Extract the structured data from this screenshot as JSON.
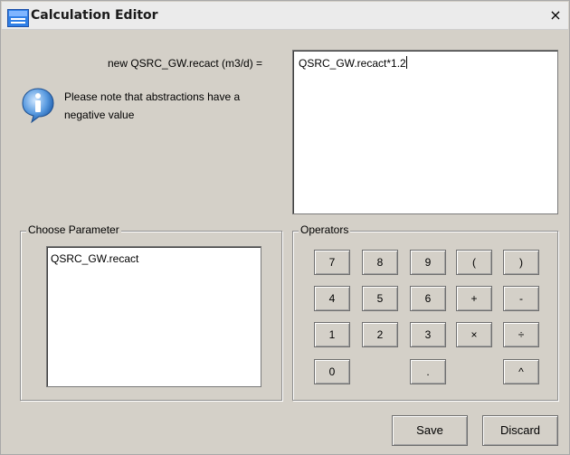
{
  "window": {
    "title": "Calculation Editor",
    "close_symbol": "×"
  },
  "result": {
    "label": "new QSRC_GW.recact (m3/d) =",
    "expression": "QSRC_GW.recact*1.2"
  },
  "note": {
    "icon": "info-icon",
    "text": "Please note that abstractions have a negative value"
  },
  "parameters": {
    "title": "Choose Parameter",
    "items": [
      "QSRC_GW.recact"
    ]
  },
  "operators": {
    "title": "Operators",
    "buttons": [
      "7",
      "8",
      "9",
      "(",
      ")",
      "4",
      "5",
      "6",
      "+",
      "-",
      "1",
      "2",
      "3",
      "×",
      "÷",
      "0",
      ".",
      "^"
    ]
  },
  "footer": {
    "save_label": "Save",
    "discard_label": "Discard"
  }
}
